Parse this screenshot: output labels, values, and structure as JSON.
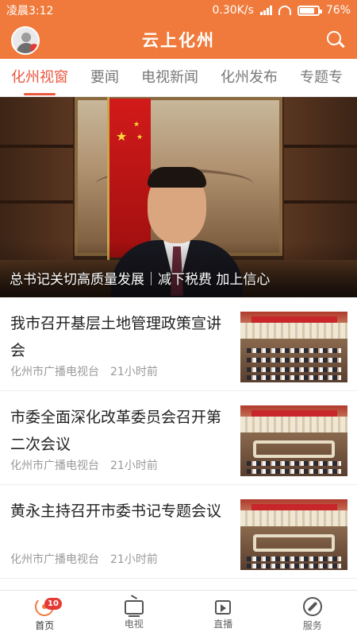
{
  "status_bar": {
    "time": "凌晨3:12",
    "network_speed": "0.30K/s",
    "battery": "76%"
  },
  "app_bar": {
    "title": "云上化州",
    "avatar_icon": "avatar-icon",
    "search_icon": "search-icon"
  },
  "tabs": [
    {
      "label": "化州视窗",
      "active": true
    },
    {
      "label": "要闻",
      "active": false
    },
    {
      "label": "电视新闻",
      "active": false
    },
    {
      "label": "化州发布",
      "active": false
    },
    {
      "label": "专题专",
      "active": false
    }
  ],
  "hero": {
    "caption": "总书记关切高质量发展｜减下税费 加上信心"
  },
  "news": [
    {
      "title": "我市召开基层土地管理政策宣讲会",
      "source": "化州市广播电视台",
      "time": "21小时前"
    },
    {
      "title": "市委全面深化改革委员会召开第二次会议",
      "source": "化州市广播电视台",
      "time": "21小时前"
    },
    {
      "title": "黄永主持召开市委书记专题会议",
      "source": "化州市广播电视台",
      "time": "21小时前"
    }
  ],
  "bottom_nav": [
    {
      "label": "首页",
      "icon": "home-icon",
      "badge": "10",
      "active": true
    },
    {
      "label": "电视",
      "icon": "tv-icon",
      "active": false
    },
    {
      "label": "直播",
      "icon": "live-video-icon",
      "active": false
    },
    {
      "label": "服务",
      "icon": "compass-icon",
      "active": false
    }
  ],
  "colors": {
    "brand": "#f07a3b",
    "active_tab": "#e9573f",
    "badge": "#e53935"
  }
}
